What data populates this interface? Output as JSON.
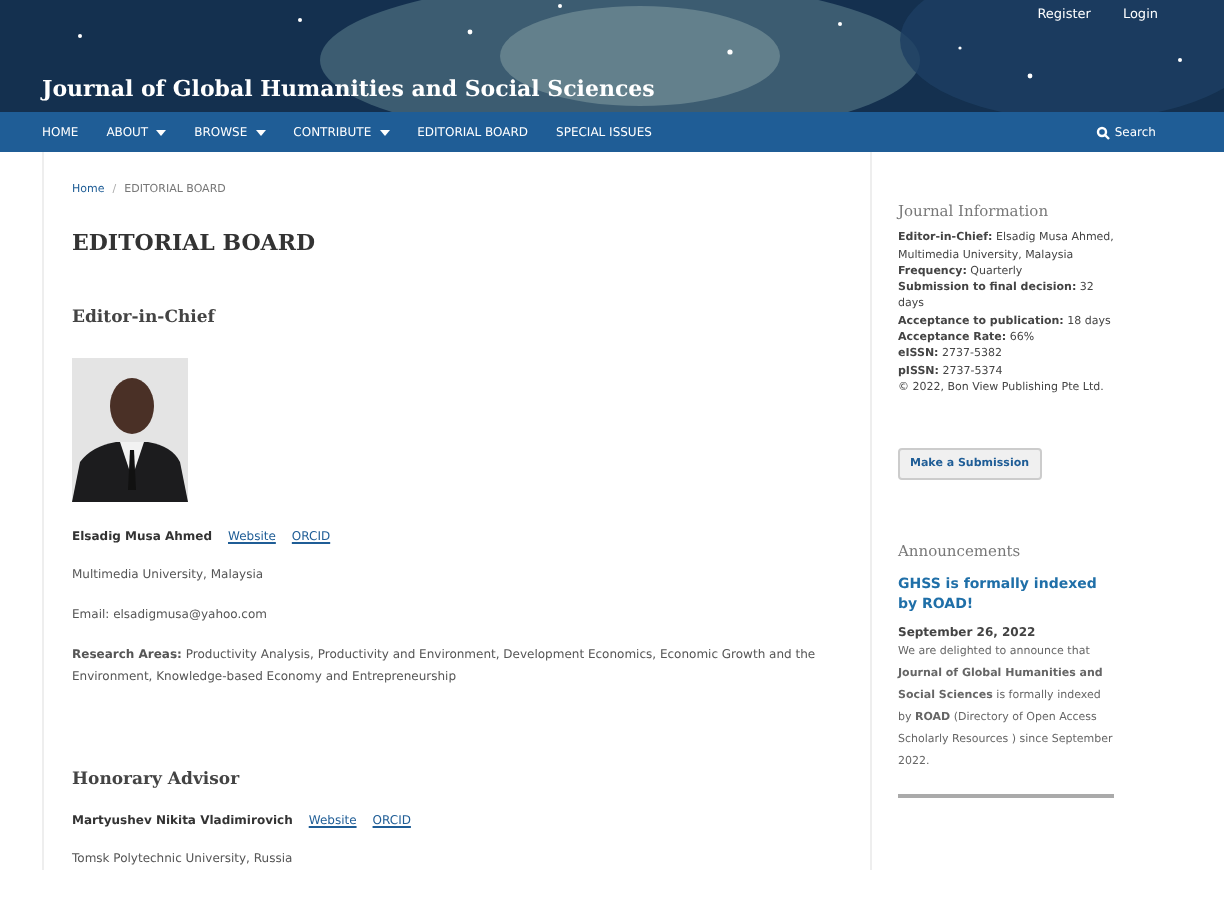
{
  "header": {
    "user_links": [
      "Register",
      "Login"
    ],
    "site_title": "Journal of Global Humanities and Social Sciences"
  },
  "nav": {
    "items": [
      {
        "label": "HOME",
        "dropdown": false
      },
      {
        "label": "ABOUT",
        "dropdown": true
      },
      {
        "label": "BROWSE",
        "dropdown": true
      },
      {
        "label": "CONTRIBUTE",
        "dropdown": true
      },
      {
        "label": "EDITORIAL BOARD",
        "dropdown": false
      },
      {
        "label": "SPECIAL ISSUES",
        "dropdown": false
      }
    ],
    "search": "Search"
  },
  "breadcrumb": {
    "home": "Home",
    "separator": "/",
    "current": "EDITORIAL BOARD"
  },
  "page_title": "EDITORIAL BOARD",
  "sections": [
    {
      "heading": "Editor-in-Chief",
      "photo": {
        "kind": "picture"
      },
      "name": "Elsadig Musa Ahmed",
      "links": [
        "Website",
        "ORCID"
      ],
      "details": [
        "Multimedia University, Malaysia",
        "Email: elsadigmusa@yahoo.com",
        "**Research Areas:** Productivity Analysis, Productivity and Environment, Development Economics, Economic Growth and the Environment, Knowledge-based Economy and Entrepreneurship"
      ]
    },
    {
      "heading": "Honorary Advisor",
      "name": "Martyushev Nikita Vladimirovich",
      "links": [
        "Website",
        "ORCID"
      ],
      "details": [
        "Tomsk Polytechnic University, Russia"
      ]
    }
  ],
  "sidebar": {
    "journal_info": {
      "title": "Journal Information",
      "lines": [
        "**Editor-in-Chief:** Elsadig Musa Ahmed, Multimedia University, Malaysia",
        "**Frequency:** Quarterly",
        "**Submission to final decision:** 32 days",
        "**Acceptance to publication:** 18 days",
        "**Acceptance Rate:** 66%",
        "**eISSN:** 2737-5382",
        "**pISSN:** 2737-5374",
        "© 2022, Bon View Publishing Pte Ltd."
      ]
    },
    "submit_button": "Make a Submission",
    "announcements": {
      "title": "Announcements",
      "items": [
        {
          "title": "GHSS is formally indexed by ROAD!",
          "date": "September 26, 2022",
          "body": "We are delighted to announce that **Journal of Global Humanities and Social Sciences** is formally indexed by **ROAD** (Directory of Open Access Scholarly Resources ) since September 2022."
        }
      ]
    }
  }
}
